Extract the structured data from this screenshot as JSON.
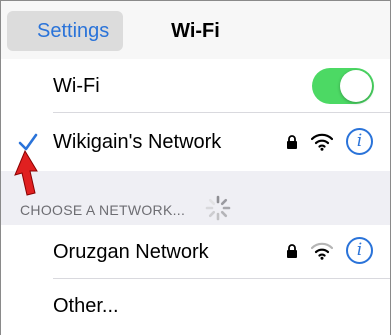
{
  "navbar": {
    "back_label": "Settings",
    "title": "Wi-Fi"
  },
  "wifi_toggle": {
    "label": "Wi-Fi",
    "on": true
  },
  "connected_network": {
    "name": "Wikigain's Network",
    "selected": true,
    "secured": true
  },
  "section": {
    "header": "CHOOSE A NETWORK..."
  },
  "networks": [
    {
      "name": "Oruzgan Network",
      "secured": true
    },
    {
      "name": "Other..."
    }
  ],
  "colors": {
    "accent": "#2a73d9",
    "toggle_on": "#4cd964",
    "background": "#efeff4",
    "annotation_arrow": "#e02020"
  }
}
